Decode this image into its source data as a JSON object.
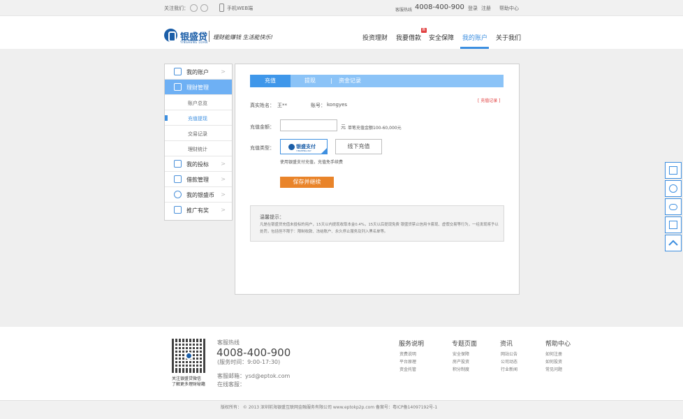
{
  "topbar": {
    "follow_label": "关注我们：",
    "mobile_label": "手机WEB端",
    "hotline_label": "客服热线",
    "hotline_number": "4008-400-900",
    "login": "登录",
    "register": "注册",
    "help": "帮助中心"
  },
  "header": {
    "logo_cn": "银盛贷",
    "logo_en": "YINSHENG LOAN",
    "slogan": "理财能赚钱 生活能快乐!",
    "nav": [
      "投资理财",
      "我要借款",
      "安全保障",
      "我的账户",
      "关于我们"
    ],
    "nav_active_index": 3,
    "badge": "新"
  },
  "sidebar": {
    "my_account": "我的账户",
    "finance": "理财管理",
    "sub": [
      "账户总览",
      "充值提现",
      "交易记录",
      "理财统计"
    ],
    "sub_current_index": 1,
    "my_bids": "我的投标",
    "loans": "借款管理",
    "coins": "我的银盛币",
    "promo": "推广有奖",
    "arrow": ">"
  },
  "main": {
    "tabs": [
      "充值",
      "提现",
      "资金记录"
    ],
    "tab_divider": "|",
    "record_link": "[ 充值记录 ]",
    "real_name_label": "真实姓名：",
    "real_name": "王**",
    "account_label": "账号：",
    "account": "kongyes",
    "amount_label": "充值金额：",
    "amount_value": "",
    "amount_unit": "元",
    "amount_hint": "单笔充值金额100-60,000元",
    "type_label": "充值类型：",
    "pay_name": "银盛支付",
    "pay_sub": "YINSHENG PAY",
    "offline_label": "线下充值",
    "pay_hint": "使用银盛支付充值，充值免手续费",
    "save_label": "保存并继续",
    "notice_title": "温馨提示：",
    "notice_body": "凡是在银盛贷充值未投标的用户，15天以内提现收取本金0.4%，15天以后提现免费 银盛贷禁止信用卡套现、虚假交易等行为，一经发现将予以处罚，包括但不限于：限制收款、冻结账户、永久停止服务及列入黑名单等。"
  },
  "footer": {
    "qr_caption_1": "关注银盛贷微信",
    "qr_caption_2": "了解更多理财秘籍",
    "hotline_label": "客服热线",
    "hotline_number": "4008-400-900",
    "service_hours": "(服务时间：9:00-17:30)",
    "email": "客服邮箱：ysd@eptok.com",
    "online": "在线客服：",
    "columns": [
      {
        "title": "服务说明",
        "links": [
          "资费说明",
          "平台原理",
          "资金托管"
        ]
      },
      {
        "title": "专题页面",
        "links": [
          "安全保障",
          "房产投资",
          "积分制度"
        ]
      },
      {
        "title": "资讯",
        "links": [
          "网站公告",
          "公司动态",
          "行业新闻"
        ]
      },
      {
        "title": "帮助中心",
        "links": [
          "如何注册",
          "如何投资",
          "常见问题"
        ]
      }
    ],
    "copyright": "版权所有：  © 2013 深圳前海银盛互联网金融服务有限公司 www.eptokp2p.com    备案号：粤ICP备14097192号-1"
  },
  "colors": {
    "accent": "#3d8fe0",
    "tab_bar": "#8bc3f7",
    "save_button": "#e9842a",
    "brand": "#1b5ea8"
  },
  "icons": [
    "wechat-circle-icon",
    "weibo-circle-icon",
    "phone-icon",
    "qr-icon",
    "support-icon",
    "chat-icon",
    "qr-scan-icon",
    "back-to-top-icon"
  ]
}
